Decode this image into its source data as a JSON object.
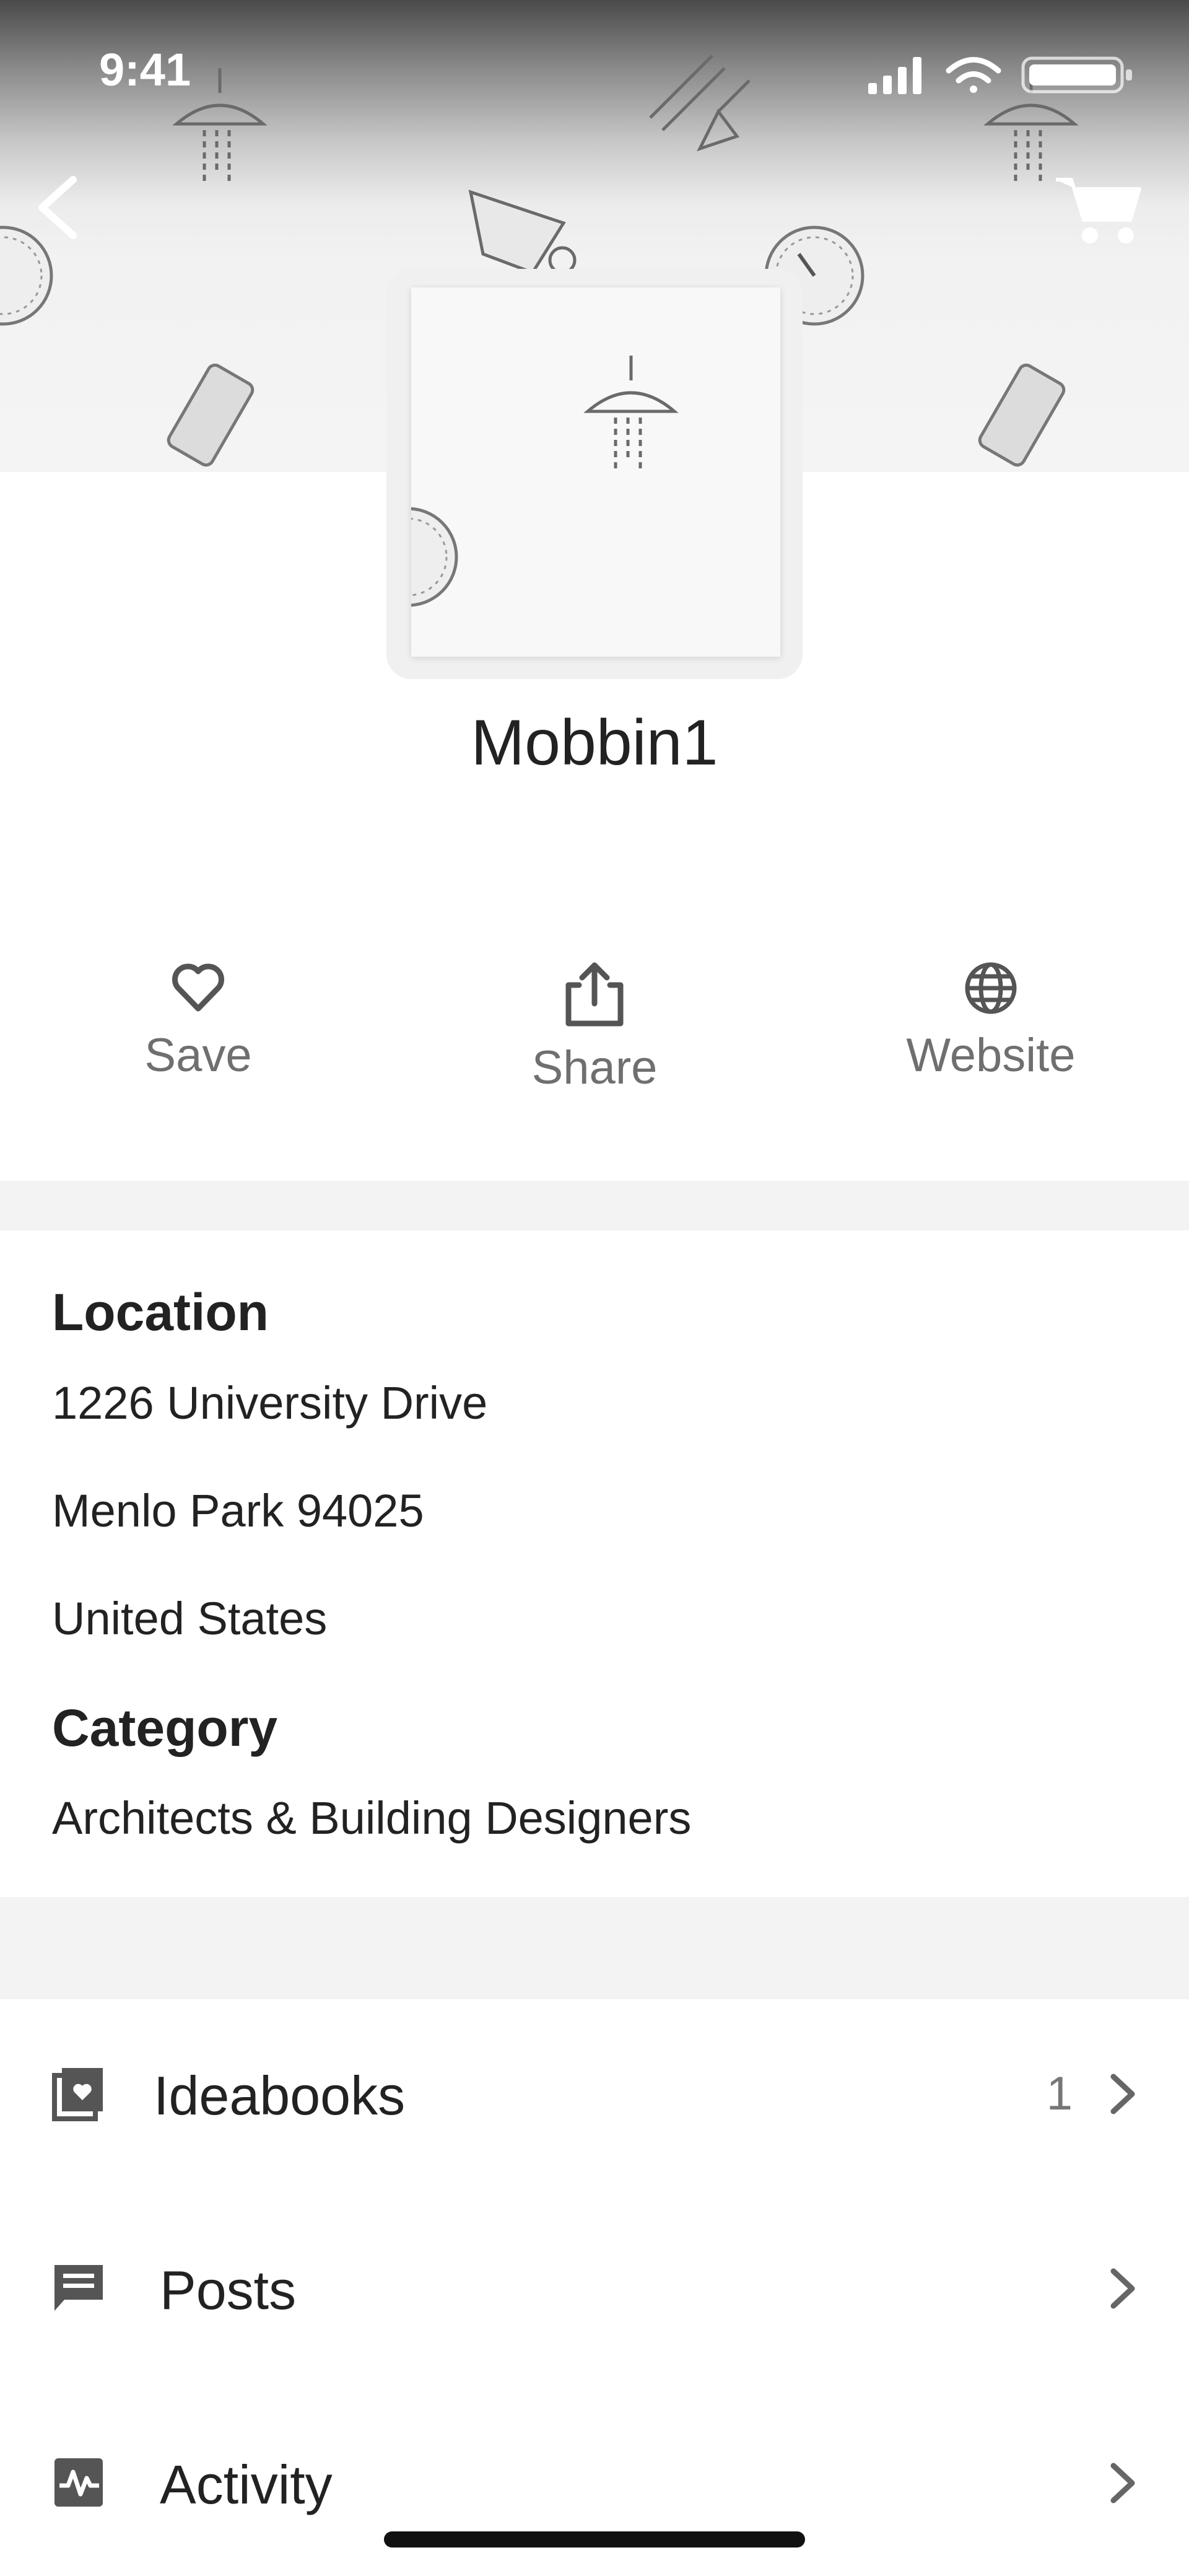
{
  "status_bar": {
    "time": "9:41"
  },
  "header": {
    "back_icon": "chevron-left-icon",
    "cart_icon": "cart-icon"
  },
  "profile": {
    "name": "Mobbin1"
  },
  "actions": [
    {
      "label": "Save",
      "icon": "heart-icon"
    },
    {
      "label": "Share",
      "icon": "share-icon"
    },
    {
      "label": "Website",
      "icon": "globe-icon"
    }
  ],
  "location": {
    "heading": "Location",
    "lines": [
      "1226 University Drive",
      "Menlo Park 94025",
      "United States"
    ]
  },
  "category": {
    "heading": "Category",
    "value": "Architects &  Building Designers"
  },
  "list": [
    {
      "label": "Ideabooks",
      "count": "1",
      "icon": "ideabook-icon"
    },
    {
      "label": "Posts",
      "count": "",
      "icon": "comment-icon"
    },
    {
      "label": "Activity",
      "count": "",
      "icon": "activity-icon"
    }
  ],
  "colors": {
    "text": "#222222",
    "secondary": "#6f6f6f",
    "divider": "#f3f3f3"
  }
}
